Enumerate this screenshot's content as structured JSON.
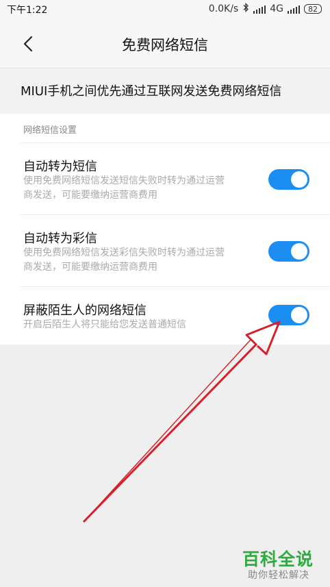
{
  "status_bar": {
    "time": "下午1:22",
    "network_speed": "0.0K/s",
    "network_type": "4G",
    "battery": "82",
    "icons": [
      "bluetooth-icon",
      "signal-icon",
      "signal-icon",
      "battery-icon"
    ]
  },
  "header": {
    "back_icon": "chevron-left-icon",
    "title": "免费网络短信"
  },
  "intro": {
    "text": "MIUI手机之间优先通过互联网发送免费网络短信"
  },
  "settings": {
    "section_title": "网络短信设置",
    "items": [
      {
        "title": "自动转为短信",
        "description_line1": "使用免费网络短信发送短信失败时转为通过运营",
        "description_line2": "商发送，可能要缴纳运营商费用",
        "enabled": true
      },
      {
        "title": "自动转为彩信",
        "description_line1": "使用免费网络短信发送彩信失败时转为通过运营",
        "description_line2": "商发送，可能要缴纳运营商费用",
        "enabled": true
      },
      {
        "title": "屏蔽陌生人的网络短信",
        "description_line1": "开启后陌生人将只能给您发送普通短信",
        "enabled": true
      }
    ]
  },
  "annotation": {
    "color": "#d6202a"
  },
  "watermark": {
    "brand": "百科全说",
    "tagline": "助你轻松解决"
  },
  "colors": {
    "toggle_on": "#1c8ef2",
    "page_background": "#efefef",
    "watermark_green": "#2eaa3e"
  }
}
